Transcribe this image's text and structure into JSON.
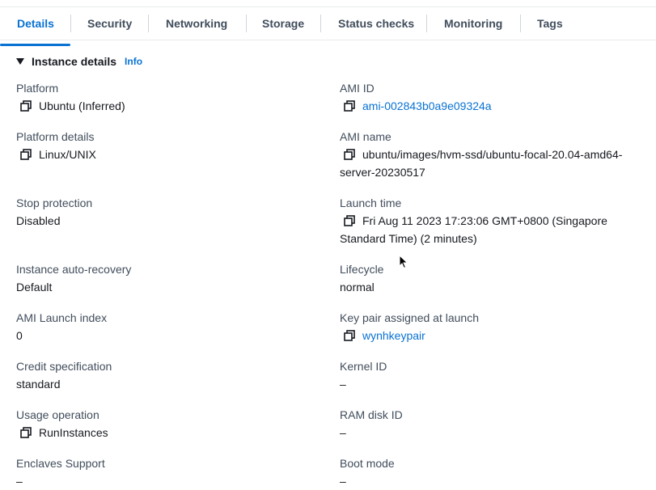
{
  "tabs": [
    "Details",
    "Security",
    "Networking",
    "Storage",
    "Status checks",
    "Monitoring",
    "Tags"
  ],
  "section": {
    "title": "Instance details",
    "info": "Info"
  },
  "left": [
    {
      "label": "Platform",
      "value": "Ubuntu (Inferred)"
    },
    {
      "label": "Platform details",
      "value": "Linux/UNIX"
    },
    {
      "label": "Stop protection",
      "value": "Disabled"
    },
    {
      "label": "Instance auto-recovery",
      "value": "Default"
    },
    {
      "label": "AMI Launch index",
      "value": "0"
    },
    {
      "label": "Credit specification",
      "value": "standard"
    },
    {
      "label": "Usage operation",
      "value": "RunInstances"
    },
    {
      "label": "Enclaves Support",
      "value": "–"
    }
  ],
  "right": [
    {
      "label": "AMI ID",
      "value": "ami-002843b0a9e09324a"
    },
    {
      "label": "AMI name",
      "value_line1": "ubuntu/images/hvm-ssd/ubuntu-focal-20.04-amd64-",
      "value_line2": "server-20230517"
    },
    {
      "label": "Launch time",
      "value_line1": "Fri Aug 11 2023 17:23:06 GMT+0800 (Singapore",
      "value_line2": "Standard Time) (2 minutes)"
    },
    {
      "label": "Lifecycle",
      "value": "normal"
    },
    {
      "label": "Key pair assigned at launch",
      "value": "wynhkeypair"
    },
    {
      "label": "Kernel ID",
      "value": "–"
    },
    {
      "label": "RAM disk ID",
      "value": "–"
    },
    {
      "label": "Boot mode",
      "value": "–"
    }
  ],
  "colors": {
    "accent": "#0972d3",
    "text": "#16191f",
    "label": "#414d5c"
  }
}
